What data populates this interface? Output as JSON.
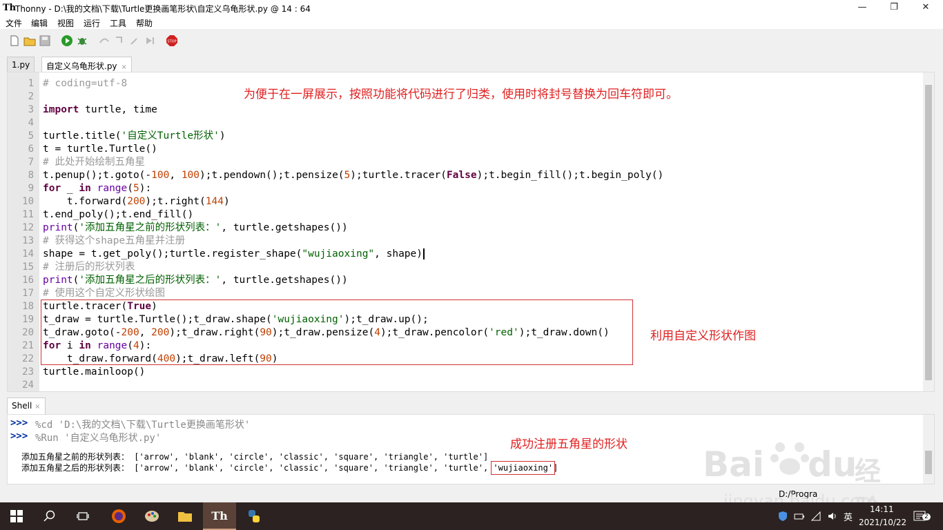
{
  "window": {
    "title": "Thonny  -  D:\\我的文档\\下载\\Turtle更换画笔形状\\自定义乌龟形状.py  @  14 : 64",
    "minimize": "—",
    "maximize": "❐",
    "close": "✕"
  },
  "menu": [
    "文件",
    "编辑",
    "视图",
    "运行",
    "工具",
    "帮助"
  ],
  "tabs": [
    {
      "label": "1.py",
      "close": "×"
    },
    {
      "label": "自定义乌龟形状.py",
      "close": "×"
    }
  ],
  "editor": {
    "line_numbers": [
      "1",
      "2",
      "3",
      "4",
      "5",
      "6",
      "7",
      "8",
      "9",
      "10",
      "11",
      "12",
      "13",
      "14",
      "15",
      "16",
      "17",
      "18",
      "19",
      "20",
      "21",
      "22",
      "23",
      "24"
    ],
    "lines": {
      "l1": "# coding=utf-8",
      "l3a": "import",
      "l3b": " turtle, time",
      "l5a": "turtle.title(",
      "l5b": "'自定义Turtle形状'",
      "l5c": ")",
      "l6": "t = turtle.Turtle()",
      "l7": "# 此处开始绘制五角星",
      "l8a": "t.penup();t.goto(-",
      "l8b": "100",
      "l8c": ", ",
      "l8d": "100",
      "l8e": ");t.pendown();t.pensize(",
      "l8f": "5",
      "l8g": ");turtle.tracer(",
      "l8h": "False",
      "l8i": ");t.begin_fill();t.begin_poly()",
      "l9a": "for",
      "l9b": " _ ",
      "l9c": "in",
      "l9d": " ",
      "l9e": "range",
      "l9f": "(",
      "l9g": "5",
      "l9h": "):",
      "l10a": "    t.forward(",
      "l10b": "200",
      "l10c": ");t.right(",
      "l10d": "144",
      "l10e": ")",
      "l11": "t.end_poly();t.end_fill()",
      "l12a": "print",
      "l12b": "(",
      "l12c": "'添加五角星之前的形状列表：'",
      "l12d": ", turtle.getshapes())",
      "l13": "# 获得这个shape五角星并注册",
      "l14a": "shape = t.get_poly();turtle.register_shape(",
      "l14b": "\"wujiaoxing\"",
      "l14c": ", shape)",
      "l15": "# 注册后的形状列表",
      "l16a": "print",
      "l16b": "(",
      "l16c": "'添加五角星之后的形状列表：'",
      "l16d": ", turtle.getshapes())",
      "l17": "# 使用这个自定义形状绘图",
      "l18a": "turtle.tracer(",
      "l18b": "True",
      "l18c": ")",
      "l19a": "t_draw = turtle.Turtle();t_draw.shape(",
      "l19b": "'wujiaoxing'",
      "l19c": ");t_draw.up();",
      "l20a": "t_draw.goto(-",
      "l20b": "200",
      "l20c": ", ",
      "l20d": "200",
      "l20e": ");t_draw.right(",
      "l20f": "90",
      "l20g": ");t_draw.pensize(",
      "l20h": "4",
      "l20i": ");t_draw.pencolor(",
      "l20j": "'red'",
      "l20k": ");t_draw.down()",
      "l21a": "for",
      "l21b": " i ",
      "l21c": "in",
      "l21d": " ",
      "l21e": "range",
      "l21f": "(",
      "l21g": "4",
      "l21h": "):",
      "l22a": "    t_draw.forward(",
      "l22b": "400",
      "l22c": ");t_draw.left(",
      "l22d": "90",
      "l22e": ")",
      "l23": "turtle.mainloop()"
    }
  },
  "annotations": {
    "top": "为便于在一屏展示，按照功能将代码进行了归类，使用时将封号替换为回车符即可。",
    "side": "利用自定义形状作图",
    "shell": "成功注册五角星的形状"
  },
  "shell": {
    "tab_label": "Shell",
    "tab_close": "×",
    "prompt": ">>>",
    "cmd1": "%cd 'D:\\我的文档\\下载\\Turtle更换画笔形状'",
    "cmd2": "%Run '自定义乌龟形状.py'",
    "out1": "添加五角星之前的形状列表： ['arrow', 'blank', 'circle', 'classic', 'square', 'triangle', 'turtle']",
    "out2a": "添加五角星之后的形状列表： ['arrow', 'blank', 'circle', 'classic', 'square', 'triangle', 'turtle', ",
    "out2b": "'wujiaoxing'",
    "out2c": "]"
  },
  "status": {
    "text": "D:/Progra"
  },
  "watermark": {
    "brand": "Bai",
    "brand2": "du",
    "cn": "经验",
    "url": "jingyan.baidu.com"
  },
  "taskbar": {
    "ime": "英",
    "time": "14:11",
    "date": "2021/10/22",
    "notifications": "2"
  },
  "colors": {
    "annotation": "#e02020",
    "taskbar": "#2b2221"
  }
}
